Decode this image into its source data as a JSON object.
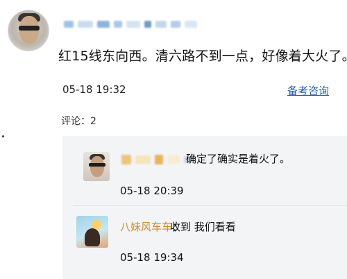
{
  "post": {
    "text": "红15线东向西。清六路不到一点，好像着大火了。",
    "time": "05-18 19:32",
    "reference_link": "备考咨询"
  },
  "comments_header": {
    "count_label": "评论：2"
  },
  "comments": [
    {
      "text": "确定了确实是着火了。",
      "time": "05-18 20:39"
    },
    {
      "user": "八妹风车车",
      "separator": "：",
      "text": "收到 我们看看",
      "time": "05-18 19:34"
    }
  ]
}
